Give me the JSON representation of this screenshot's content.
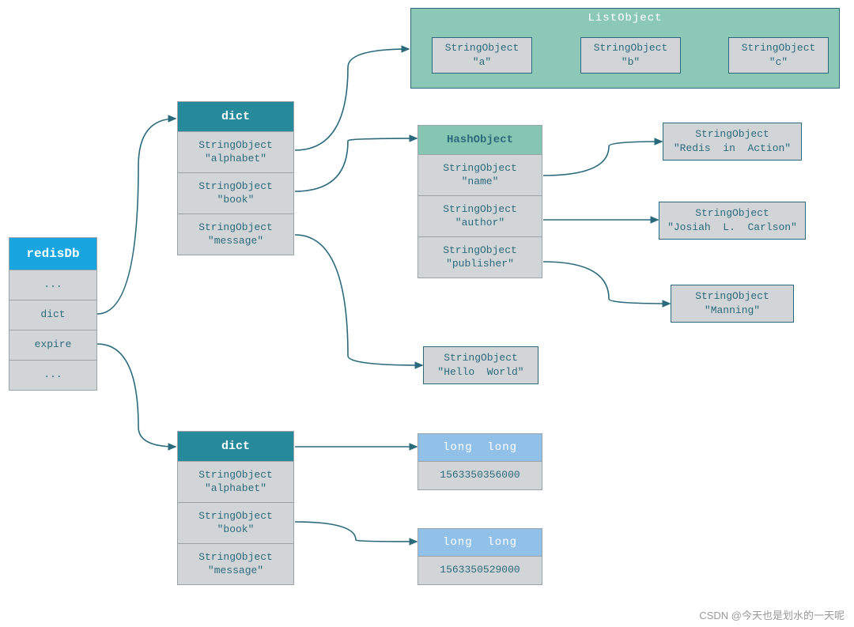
{
  "redisDb": {
    "title": "redisDb",
    "rows": [
      "...",
      "dict",
      "expire",
      "..."
    ]
  },
  "dict1": {
    "title": "dict",
    "rows": [
      {
        "l1": "StringObject",
        "l2": "\"alphabet\""
      },
      {
        "l1": "StringObject",
        "l2": "\"book\""
      },
      {
        "l1": "StringObject",
        "l2": "\"message\""
      }
    ]
  },
  "dict2": {
    "title": "dict",
    "rows": [
      {
        "l1": "StringObject",
        "l2": "\"alphabet\""
      },
      {
        "l1": "StringObject",
        "l2": "\"book\""
      },
      {
        "l1": "StringObject",
        "l2": "\"message\""
      }
    ]
  },
  "listObject": {
    "title": "ListObject",
    "items": [
      {
        "l1": "StringObject",
        "l2": "\"a\""
      },
      {
        "l1": "StringObject",
        "l2": "\"b\""
      },
      {
        "l1": "StringObject",
        "l2": "\"c\""
      }
    ]
  },
  "hashObject": {
    "title": "HashObject",
    "rows": [
      {
        "l1": "StringObject",
        "l2": "\"name\""
      },
      {
        "l1": "StringObject",
        "l2": "\"author\""
      },
      {
        "l1": "StringObject",
        "l2": "\"publisher\""
      }
    ]
  },
  "strings": {
    "redisAction": {
      "l1": "StringObject",
      "l2": "\"Redis  in  Action\""
    },
    "josiah": {
      "l1": "StringObject",
      "l2": "\"Josiah  L.  Carlson\""
    },
    "manning": {
      "l1": "StringObject",
      "l2": "\"Manning\""
    },
    "hello": {
      "l1": "StringObject",
      "l2": "\"Hello  World\""
    }
  },
  "long1": {
    "title": "long  long",
    "value": "1563350356000"
  },
  "long2": {
    "title": "long  long",
    "value": "1563350529000"
  },
  "watermark": "CSDN @今天也是划水的一天呢"
}
